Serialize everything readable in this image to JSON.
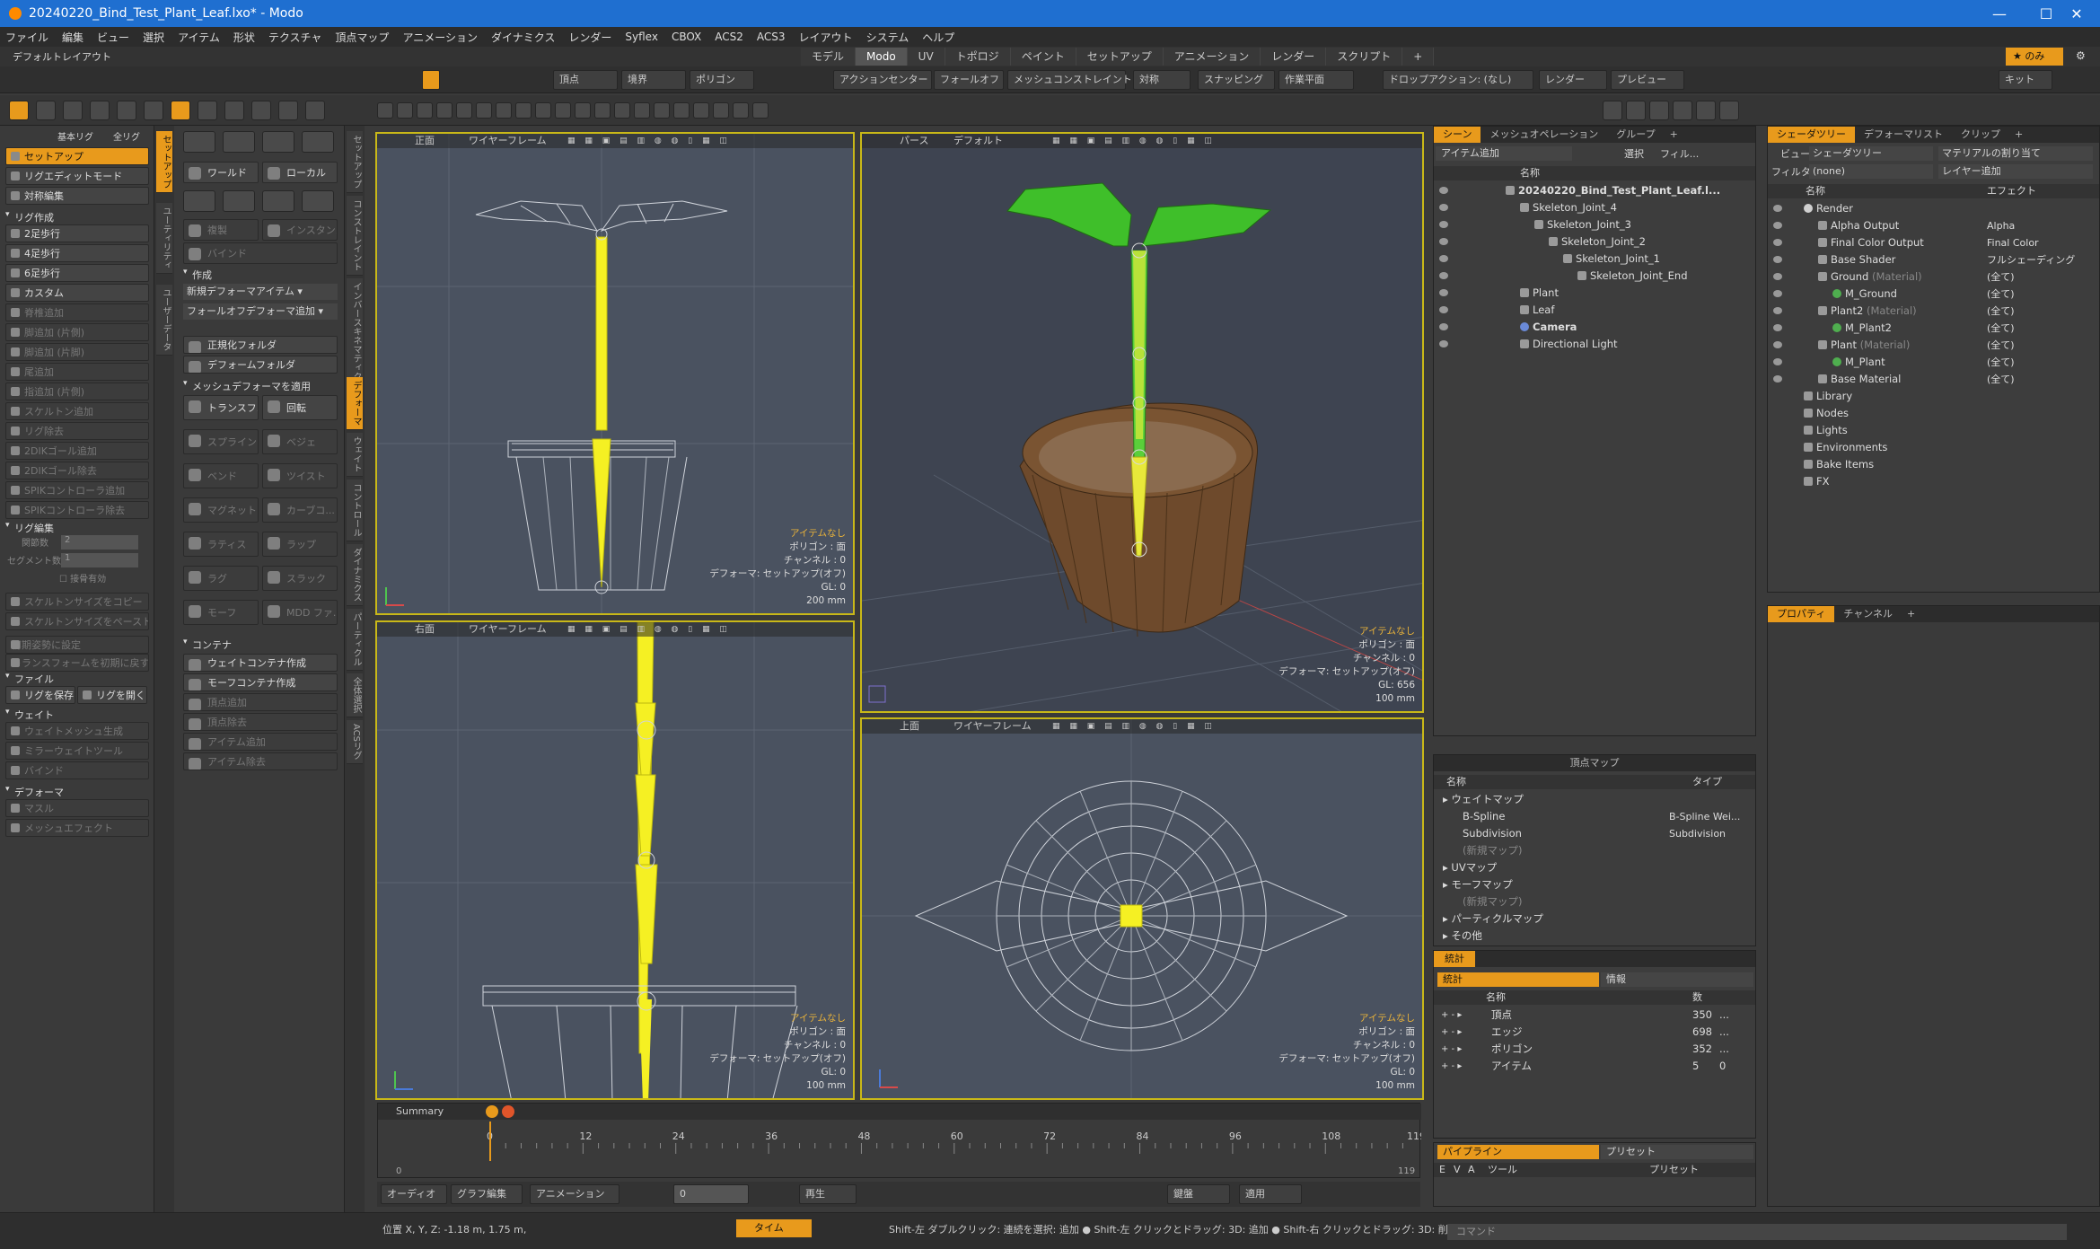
{
  "window": {
    "title": "20240220_Bind_Test_Plant_Leaf.lxo* - Modo",
    "minimize": "—",
    "maximize": "☐",
    "close": "✕"
  },
  "menu": [
    "ファイル",
    "編集",
    "ビュー",
    "選択",
    "アイテム",
    "形状",
    "テクスチャ",
    "頂点マップ",
    "アニメーション",
    "ダイナミクス",
    "レンダー",
    "Syflex",
    "CBOX",
    "ACS2",
    "ACS3",
    "レイアウト",
    "システム",
    "ヘルプ"
  ],
  "layout": {
    "name": "デフォルトレイアウト",
    "tabs": [
      "モデル",
      "Modo",
      "UV",
      "トポロジ",
      "ペイント",
      "セットアップ",
      "アニメーション",
      "レンダー",
      "スクリプト"
    ],
    "active_tab": "Modo",
    "right_label": "のみ"
  },
  "toolbar": {
    "vertex": "頂点",
    "edge": "境界",
    "polygon": "ポリゴン",
    "action_center": "アクションセンター",
    "falloff": "フォールオフ",
    "mesh_constraint": "メッシュコンストレイント",
    "symmetry": "対称",
    "snapping": "スナッピング",
    "workplane": "作業平面",
    "drop_action": "ドロップアクション: (なし)",
    "render": "レンダー",
    "preview": "プレビュー",
    "kit": "キット"
  },
  "left_panel": {
    "dropdown1": "基本リグ",
    "dropdown2": "全リグ",
    "items": [
      "セットアップ",
      "リグエディットモード",
      "対称編集"
    ],
    "rig_create_head": "リグ作成",
    "rig_create": [
      "2足歩行",
      "4足歩行",
      "6足歩行",
      "カスタム"
    ],
    "rig_disabled": [
      "脊椎追加",
      "脚追加 (片側)",
      "脚追加 (片脚)",
      "尾追加",
      "指追加 (片側)",
      "スケルトン追加",
      "リグ除去",
      "2DIKゴール追加",
      "2DIKゴール除去",
      "SPIKコントローラ追加",
      "SPIKコントローラ除去"
    ],
    "rig_edit_head": "リグ編集",
    "joints_label": "関節数",
    "joints_value": "2",
    "segment_label": "セグメント数",
    "segment_value": "1",
    "bone_valid": "接骨有効",
    "skeleton": [
      "スケルトンサイズをコピー",
      "スケルトンサイズをペースト"
    ],
    "reset": [
      "初期姿勢に設定",
      "トランスフォームを初期に戻す"
    ],
    "file_head": "ファイル",
    "save_rig": "リグを保存",
    "open_rig": "リグを開く",
    "weight_head": "ウェイト",
    "weight": [
      "ウェイトメッシュ生成",
      "ミラーウェイトツール",
      "バインド"
    ],
    "deform_head": "デフォーマ",
    "deform": [
      "マスル",
      "メッシュエフェクト"
    ]
  },
  "vtabs_left": [
    "セットアップ",
    "ユーティリティ",
    "ユーザーデータ"
  ],
  "mid_panel": {
    "world": "ワールド",
    "local": "ローカル",
    "dup": "複製",
    "instance": "インスタンス",
    "bind": "バインド",
    "create_head": "作成",
    "new_deformer": "新規デフォーマアイテム",
    "falloff_add": "フォールオフデフォーマ追加",
    "norm_folder": "正規化フォルダ",
    "deform_folder": "デフォームフォルダ",
    "mesh_deform_head": "メッシュデフォーマを適用",
    "deformers": [
      [
        "トランスフ...",
        "回転"
      ],
      [
        "スプライン",
        "ベジェ"
      ],
      [
        "ベンド",
        "ツイスト"
      ],
      [
        "マグネット",
        "カーブコ..."
      ],
      [
        "ラティス",
        "ラップ"
      ],
      [
        "ラグ",
        "スラック"
      ],
      [
        "モーフ",
        "MDD ファ..."
      ]
    ],
    "container_head": "コンテナ",
    "container": [
      "ウェイトコンテナ作成",
      "モーフコンテナ作成",
      "頂点追加",
      "頂点除去",
      "アイテム追加",
      "アイテム除去"
    ]
  },
  "vtabs_right": [
    "セットアップ",
    "コンストレイント",
    "インバースキネマティクス",
    "デフォーマ",
    "ウェイト",
    "コントロール",
    "ダイナミクス",
    "パーティクル",
    "全体選択",
    "ACSリグ"
  ],
  "viewports": [
    {
      "name": "正面",
      "mode": "ワイヤーフレーム",
      "info": [
        "アイテムなし",
        "ポリゴン : 面",
        "チャンネル : 0",
        "デフォーマ: セットアップ(オフ)",
        "GL: 0",
        "200 mm"
      ]
    },
    {
      "name": "パース",
      "mode": "デフォルト",
      "info": [
        "アイテムなし",
        "ポリゴン : 面",
        "チャンネル : 0",
        "デフォーマ: セットアップ(オフ)",
        "GL: 656",
        "100 mm"
      ]
    },
    {
      "name": "右面",
      "mode": "ワイヤーフレーム",
      "info": [
        "アイテムなし",
        "ポリゴン : 面",
        "チャンネル : 0",
        "デフォーマ: セットアップ(オフ)",
        "GL: 0",
        "100 mm"
      ]
    },
    {
      "name": "上面",
      "mode": "ワイヤーフレーム",
      "info": [
        "アイテムなし",
        "ポリゴン : 面",
        "チャンネル : 0",
        "デフォーマ: セットアップ(オフ)",
        "GL: 0",
        "100 mm"
      ]
    }
  ],
  "timeline": {
    "summary": "Summary",
    "ticks": [
      "0",
      "12",
      "24",
      "36",
      "48",
      "60",
      "72",
      "84",
      "96",
      "108",
      "119"
    ],
    "ruler_start": "0",
    "ruler_end": "119"
  },
  "bottombar": {
    "audio": "オーディオ",
    "graph": "グラフ編集",
    "animation": "アニメーション",
    "frame": "0",
    "play": "再生",
    "key": "鍵盤",
    "apply": "適用"
  },
  "status": {
    "position": "位置 X, Y, Z:  -1.18 m, 1.75 m,",
    "time": "タイム",
    "hint": "Shift-左 ダブルクリック: 連続を選択: 追加 ● Shift-左 クリックとドラッグ: 3D: 追加 ● Shift-右 クリックとドラッグ: 3D: 削...",
    "command": "コマンド"
  },
  "scene_panel": {
    "tabs": [
      "シーン",
      "メッシュオペレーション",
      "グループ"
    ],
    "add_item": "アイテム追加",
    "select": "選択",
    "filter": "フィル...",
    "name_col": "名称",
    "items": [
      {
        "label": "20240220_Bind_Test_Plant_Leaf.l...",
        "indent": 0,
        "bold": true
      },
      {
        "label": "Skeleton_Joint_4",
        "indent": 1
      },
      {
        "label": "Skeleton_Joint_3",
        "indent": 2
      },
      {
        "label": "Skeleton_Joint_2",
        "indent": 3
      },
      {
        "label": "Skeleton_Joint_1",
        "indent": 4
      },
      {
        "label": "Skeleton_Joint_End",
        "indent": 5
      },
      {
        "label": "Plant",
        "indent": 1
      },
      {
        "label": "Leaf",
        "indent": 1
      },
      {
        "label": "Camera",
        "indent": 1,
        "bold": true
      },
      {
        "label": "Directional Light",
        "indent": 1
      }
    ]
  },
  "shader_panel": {
    "tabs": [
      "シェーダツリー",
      "デフォーマリスト",
      "クリップ"
    ],
    "view": "ビュー",
    "view_value": "シェーダツリー",
    "assign": "マテリアルの割り当て",
    "filter": "フィルター",
    "filter_value": "(none)",
    "layer_add": "レイヤー追加",
    "name_col": "名称",
    "effect_col": "エフェクト",
    "rows": [
      {
        "name": "Render",
        "sub": "",
        "effect": "",
        "indent": 0
      },
      {
        "name": "Alpha Output",
        "sub": "",
        "effect": "Alpha",
        "indent": 1
      },
      {
        "name": "Final Color Output",
        "sub": "",
        "effect": "Final Color",
        "indent": 1
      },
      {
        "name": "Base Shader",
        "sub": "",
        "effect": "フルシェーディング",
        "indent": 1
      },
      {
        "name": "Ground",
        "sub": "(Material)",
        "effect": "(全て)",
        "indent": 1
      },
      {
        "name": "M_Ground",
        "sub": "",
        "effect": "(全て)",
        "indent": 2
      },
      {
        "name": "Plant2",
        "sub": "(Material)",
        "effect": "(全て)",
        "indent": 1
      },
      {
        "name": "M_Plant2",
        "sub": "",
        "effect": "(全て)",
        "indent": 2
      },
      {
        "name": "Plant",
        "sub": "(Material)",
        "effect": "(全て)",
        "indent": 1
      },
      {
        "name": "M_Plant",
        "sub": "",
        "effect": "(全て)",
        "indent": 2
      },
      {
        "name": "Base Material",
        "sub": "",
        "effect": "(全て)",
        "indent": 1
      },
      {
        "name": "Library",
        "sub": "",
        "effect": "",
        "indent": 0
      },
      {
        "name": "Nodes",
        "sub": "",
        "effect": "",
        "indent": 0
      },
      {
        "name": "Lights",
        "sub": "",
        "effect": "",
        "indent": 0
      },
      {
        "name": "Environments",
        "sub": "",
        "effect": "",
        "indent": 0
      },
      {
        "name": "Bake Items",
        "sub": "",
        "effect": "",
        "indent": 0
      },
      {
        "name": "FX",
        "sub": "",
        "effect": "",
        "indent": 0
      }
    ]
  },
  "props_panel": {
    "tabs": [
      "プロパティ",
      "チャンネル"
    ]
  },
  "vmap_panel": {
    "title": "頂点マップ",
    "name_col": "名称",
    "type_col": "タイプ",
    "rows": [
      {
        "name": "ウェイトマップ",
        "type": "",
        "indent": 0
      },
      {
        "name": "B-Spline",
        "type": "B-Spline Wei...",
        "indent": 1
      },
      {
        "name": "Subdivision",
        "type": "Subdivision",
        "indent": 1
      },
      {
        "name": "(新規マップ)",
        "type": "",
        "indent": 1,
        "dim": true
      },
      {
        "name": "UVマップ",
        "type": "",
        "indent": 0
      },
      {
        "name": "モーフマップ",
        "type": "",
        "indent": 0
      },
      {
        "name": "(新規マップ)",
        "type": "",
        "indent": 1,
        "dim": true
      },
      {
        "name": "パーティクルマップ",
        "type": "",
        "indent": 0
      },
      {
        "name": "その他",
        "type": "",
        "indent": 0
      }
    ]
  },
  "stats_panel": {
    "tabs": [
      "統計"
    ],
    "sub_tabs": [
      "統計",
      "情報"
    ],
    "name_col": "名称",
    "count_col": "数",
    "rows": [
      {
        "name": "頂点",
        "count": "350",
        "extra": "..."
      },
      {
        "name": "エッジ",
        "count": "698",
        "extra": "..."
      },
      {
        "name": "ポリゴン",
        "count": "352",
        "extra": "..."
      },
      {
        "name": "アイテム",
        "count": "5",
        "extra": "0"
      }
    ]
  },
  "pipeline_panel": {
    "tabs": [
      "パイプライン",
      "プリセット"
    ],
    "cols": [
      "E",
      "V",
      "A",
      "ツール",
      "プリセット"
    ]
  },
  "colors": {
    "accent": "#e89a1c",
    "viewport_border": "#c9b818",
    "bone": "#f5f023",
    "leaf": "#3fbf2a",
    "pot": "#6e4a2c",
    "titlebar": "#1f6fd0"
  }
}
